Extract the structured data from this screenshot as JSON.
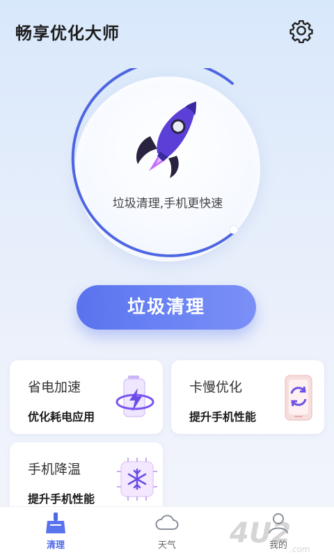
{
  "header": {
    "title": "畅享优化大师"
  },
  "hero": {
    "caption": "垃圾清理,手机更快速"
  },
  "clean_button": {
    "label": "垃圾清理"
  },
  "cards": [
    {
      "title": "省电加速",
      "subtitle": "优化耗电应用"
    },
    {
      "title": "卡慢优化",
      "subtitle": "提升手机性能"
    },
    {
      "title": "手机降温",
      "subtitle": "提升手机性能"
    }
  ],
  "tabs": [
    {
      "label": "清理",
      "active": true
    },
    {
      "label": "天气",
      "active": false
    },
    {
      "label": "我的",
      "active": false
    }
  ],
  "watermark": {
    "text": "4u2.com"
  },
  "colors": {
    "accent": "#5a73ee",
    "rocket": "#5b3fd6",
    "flame": "#c56bff"
  },
  "icons": [
    "gear-icon",
    "rocket-icon",
    "battery-lightning-icon",
    "phone-refresh-icon",
    "snowflake-chip-icon",
    "broom-icon",
    "cloud-icon",
    "person-icon"
  ]
}
